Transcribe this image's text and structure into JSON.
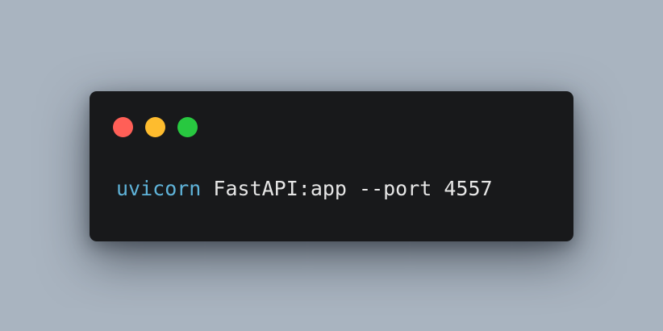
{
  "terminal": {
    "controls": [
      {
        "name": "close",
        "color": "#ff5f57"
      },
      {
        "name": "minimize",
        "color": "#febc2e"
      },
      {
        "name": "zoom",
        "color": "#28c840"
      }
    ],
    "command": "uvicorn",
    "arguments": " FastAPI:app --port 4557",
    "command_color": "#5fb3d9",
    "text_color": "#e6e6e6",
    "background_color": "#18191b"
  },
  "page": {
    "background_color": "#a9b4c0"
  }
}
